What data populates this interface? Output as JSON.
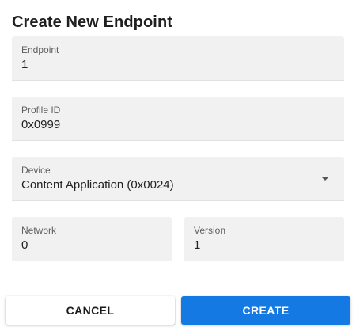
{
  "dialog": {
    "title": "Create New Endpoint"
  },
  "fields": {
    "endpoint": {
      "label": "Endpoint",
      "value": "1"
    },
    "profile_id": {
      "label": "Profile ID",
      "value": "0x0999"
    },
    "device": {
      "label": "Device",
      "value": "Content Application (0x0024)",
      "icon": "chevron-down-icon"
    },
    "network": {
      "label": "Network",
      "value": "0"
    },
    "version": {
      "label": "Version",
      "value": "1"
    }
  },
  "actions": {
    "cancel_label": "CANCEL",
    "create_label": "CREATE"
  },
  "colors": {
    "accent": "#1479e3",
    "field_background": "#f1f1f1"
  }
}
